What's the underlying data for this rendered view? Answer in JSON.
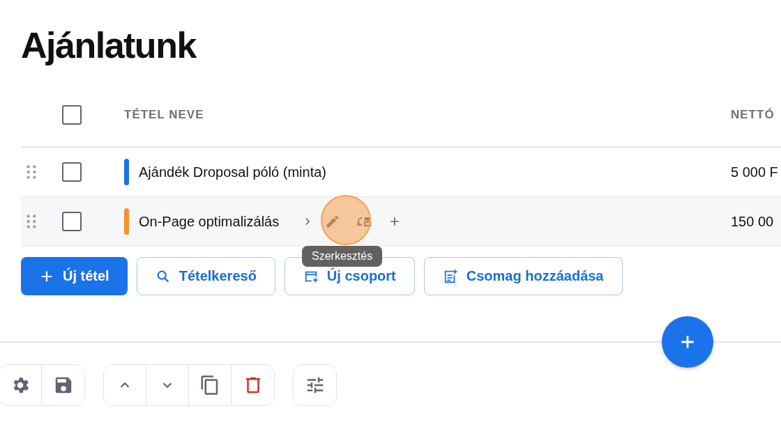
{
  "title": "Ajánlatunk",
  "table": {
    "columns": [
      "TÉTEL NEVE",
      "NETTÓ"
    ],
    "header_checkbox": {
      "checked": false
    },
    "rows": [
      {
        "name": "Ajándék Droposal póló (minta)",
        "price": "5 000 F",
        "color": "#1a73e8",
        "checked": false,
        "hovered": false
      },
      {
        "name": "On-Page optimalizálás",
        "price": "150 00",
        "color": "#f29427",
        "checked": false,
        "hovered": true
      }
    ]
  },
  "buttons": [
    {
      "label": "Új tétel",
      "kind": "primary"
    },
    {
      "label": "Tételkereső",
      "kind": "outline"
    },
    {
      "label": "Új csoport",
      "kind": "outline"
    },
    {
      "label": "Csomag hozzáadása",
      "kind": "outline"
    }
  ],
  "tooltip": {
    "text": "Szerkesztés"
  }
}
